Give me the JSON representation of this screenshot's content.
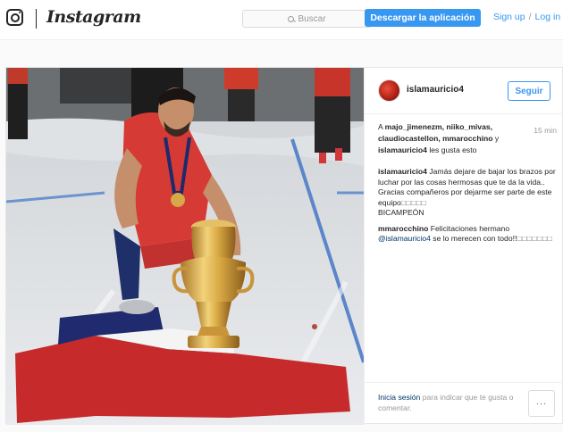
{
  "nav": {
    "brand": "Instagram",
    "search_placeholder": "Buscar",
    "download_label": "Descargar la aplicación",
    "signup_label": "Sign up",
    "separator": "/",
    "login_label": "Log in"
  },
  "post": {
    "username": "islamauricio4",
    "follow_label": "Seguir",
    "time": "15 min",
    "likes": {
      "users": "majo_jimenezm, niiko_mivas, claudiocastellon, mmarocchino",
      "conj": "y",
      "last_user": "islamauricio4",
      "suffix": "les gusta esto",
      "prefix": "A"
    },
    "caption": {
      "user": "islamauricio4",
      "text": "Jamás dejare de bajar los brazos por luchar por las cosas hermosas que te da la vida..",
      "text2": "Gracias compañeros por dejarme ser parte de este equipo",
      "tofu": "□□□□□",
      "text3": "BICAMPEÓN"
    },
    "comments": [
      {
        "user": "mmarocchino",
        "text": "Felicitaciones hermano",
        "mention": "@islamauricio4",
        "text2": "se lo merecen con todo!!",
        "tofu": "□□□□□□□"
      }
    ],
    "footer": {
      "login_link": "Inicia sesión",
      "login_text": "para indicar que te gusta o comentar."
    },
    "more_dots": "..."
  },
  "colors": {
    "accent": "#3897f0",
    "link": "#003569",
    "muted": "#999999"
  }
}
